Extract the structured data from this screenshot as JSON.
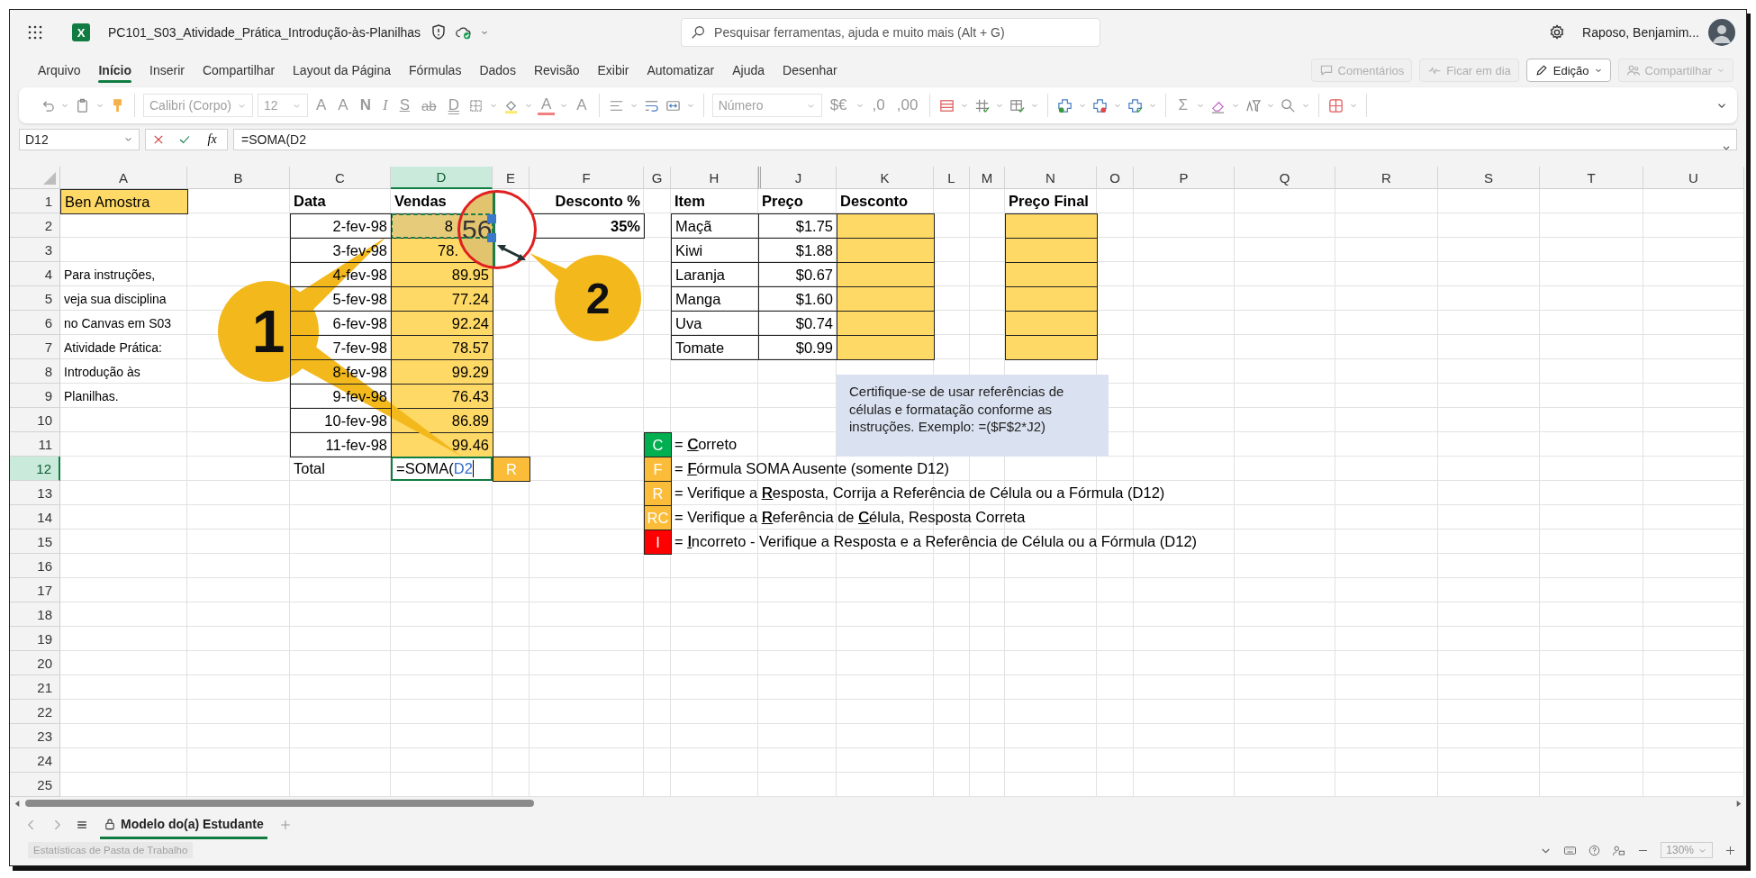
{
  "app": {
    "logo_letter": "X",
    "title": "PC101_S03_Atividade_Prática_Introdução-às-Planilhas",
    "search_placeholder": "Pesquisar ferramentas, ajuda e muito mais (Alt + G)",
    "user": "Raposo, Benjamim..."
  },
  "ribbon_tabs": [
    {
      "label": "Arquivo",
      "selected": false
    },
    {
      "label": "Início",
      "selected": true
    },
    {
      "label": "Inserir",
      "selected": false
    },
    {
      "label": "Compartilhar",
      "selected": false
    },
    {
      "label": "Layout da Página",
      "selected": false
    },
    {
      "label": "Fórmulas",
      "selected": false
    },
    {
      "label": "Dados",
      "selected": false
    },
    {
      "label": "Revisão",
      "selected": false
    },
    {
      "label": "Exibir",
      "selected": false
    },
    {
      "label": "Automatizar",
      "selected": false
    },
    {
      "label": "Ajuda",
      "selected": false
    },
    {
      "label": "Desenhar",
      "selected": false
    }
  ],
  "ribbon_buttons": [
    {
      "label": "Comentários",
      "disabled": true
    },
    {
      "label": "Ficar em dia",
      "disabled": true
    },
    {
      "label": "Edição",
      "disabled": false
    },
    {
      "label": "Compartilhar",
      "disabled": true
    }
  ],
  "toolbar": {
    "font": "Calibri (Corpo)",
    "size": "12",
    "grow_font": "A",
    "shrink_font": "A",
    "bold": "N",
    "italic": "I",
    "underline": "S",
    "strikethrough": "ab",
    "double_underline": "D",
    "font_color": "A",
    "clear_format": "A",
    "number_format": "Número",
    "currency": "$€",
    "increase_decimal": ",0",
    "decrease_decimal": ",00",
    "sum": "Σ"
  },
  "formula_bar": {
    "name_box": "D12",
    "function_label": "fx",
    "formula": "=SOMA(D2"
  },
  "sheet": {
    "columns": [
      {
        "label": "A",
        "selected": false
      },
      {
        "label": "B",
        "selected": false
      },
      {
        "label": "C",
        "selected": false
      },
      {
        "label": "D",
        "selected": true
      },
      {
        "label": "E",
        "selected": false
      },
      {
        "label": "F",
        "selected": false
      },
      {
        "label": "G",
        "selected": false
      },
      {
        "label": "H",
        "selected": false
      },
      {
        "label": "J",
        "selected": false
      },
      {
        "label": "K",
        "selected": false
      },
      {
        "label": "L",
        "selected": false
      },
      {
        "label": "M",
        "selected": false
      },
      {
        "label": "N",
        "selected": false
      },
      {
        "label": "O",
        "selected": false
      },
      {
        "label": "P",
        "selected": false
      },
      {
        "label": "Q",
        "selected": false
      },
      {
        "label": "R",
        "selected": false
      },
      {
        "label": "S",
        "selected": false
      },
      {
        "label": "T",
        "selected": false
      },
      {
        "label": "U",
        "selected": false
      }
    ],
    "rows": [
      {
        "label": "1",
        "selected": false
      },
      {
        "label": "2",
        "selected": false
      },
      {
        "label": "3",
        "selected": false
      },
      {
        "label": "4",
        "selected": false
      },
      {
        "label": "5",
        "selected": false
      },
      {
        "label": "6",
        "selected": false
      },
      {
        "label": "7",
        "selected": false
      },
      {
        "label": "8",
        "selected": false
      },
      {
        "label": "9",
        "selected": false
      },
      {
        "label": "10",
        "selected": false
      },
      {
        "label": "11",
        "selected": false
      },
      {
        "label": "12",
        "selected": true
      },
      {
        "label": "13",
        "selected": false
      },
      {
        "label": "14",
        "selected": false
      },
      {
        "label": "15",
        "selected": false
      },
      {
        "label": "16",
        "selected": false
      },
      {
        "label": "17",
        "selected": false
      },
      {
        "label": "18",
        "selected": false
      },
      {
        "label": "19",
        "selected": false
      },
      {
        "label": "20",
        "selected": false
      },
      {
        "label": "21",
        "selected": false
      },
      {
        "label": "22",
        "selected": false
      },
      {
        "label": "23",
        "selected": false
      },
      {
        "label": "24",
        "selected": false
      },
      {
        "label": "25",
        "selected": false
      }
    ],
    "name_cell": "Ben Amostra",
    "instructions": [
      "Para instruções,",
      "veja sua disciplina",
      "no Canvas em S03",
      "Atividade Prática:",
      "Introdução às",
      "Planilhas."
    ],
    "sales": {
      "headers": [
        "Data",
        "Vendas"
      ],
      "rows": [
        {
          "date": "2-fev-98",
          "sales": "8",
          "referenced": true
        },
        {
          "date": "3-fev-98",
          "sales": "78.",
          "referenced": false
        },
        {
          "date": "4-fev-98",
          "sales": "89.95",
          "referenced": false
        },
        {
          "date": "5-fev-98",
          "sales": "77.24",
          "referenced": false
        },
        {
          "date": "6-fev-98",
          "sales": "92.24",
          "referenced": false
        },
        {
          "date": "7-fev-98",
          "sales": "78.57",
          "referenced": false
        },
        {
          "date": "8-fev-98",
          "sales": "99.29",
          "referenced": false
        },
        {
          "date": "9-fev-98",
          "sales": "76.43",
          "referenced": false
        },
        {
          "date": "10-fev-98",
          "sales": "86.89",
          "referenced": false
        },
        {
          "date": "11-fev-98",
          "sales": "99.46",
          "referenced": false
        }
      ],
      "total_label": "Total",
      "formula": "=SOMA(",
      "formula_ref": "D2",
      "status": {
        "code": "R",
        "color": "#fbbd39"
      }
    },
    "discount": {
      "header": "Desconto %",
      "value": "35%"
    },
    "prices": {
      "headers": [
        "Item",
        "Preço",
        "Desconto",
        "Preço Final"
      ],
      "rows": [
        {
          "item": "Maçã",
          "price": "$1.75"
        },
        {
          "item": "Kiwi",
          "price": "$1.88"
        },
        {
          "item": "Laranja",
          "price": "$0.67"
        },
        {
          "item": "Manga",
          "price": "$1.60"
        },
        {
          "item": "Uva",
          "price": "$0.74"
        },
        {
          "item": "Tomate",
          "price": "$0.99"
        }
      ]
    },
    "note": "Certifique-se de usar referências de células e formatação conforme as instruções. Exemplo: =($F$2*J2)",
    "legend": [
      {
        "code": "C",
        "color": "#00b050",
        "text": "= **C**orreto"
      },
      {
        "code": "F",
        "color": "#fbbd39",
        "text": "= **F**órmula SOMA Ausente (somente D12)"
      },
      {
        "code": "R",
        "color": "#fbbd39",
        "text": "= Verifique a **R**esposta, Corrija a Referência de Célula ou a Fórmula (D12)"
      },
      {
        "code": "RC",
        "color": "#fbbd39",
        "text": "= Verifique a **R**eferência de **C**élula, Resposta Correta"
      },
      {
        "code": "I",
        "color": "#ff0000",
        "text": "= **I**ncorreto - Verifique a Resposta e a Referência de Célula ou a Fórmula (D12)"
      }
    ],
    "callouts": [
      {
        "label": "1"
      },
      {
        "label": "2"
      }
    ],
    "magnifier_text": "56"
  },
  "sheet_tabs": [
    {
      "label": "Modelo do(a) Estudante",
      "selected": true
    }
  ],
  "status_bar": {
    "stats": "Estatísticas de Pasta de Trabalho",
    "zoom": "130%"
  }
}
